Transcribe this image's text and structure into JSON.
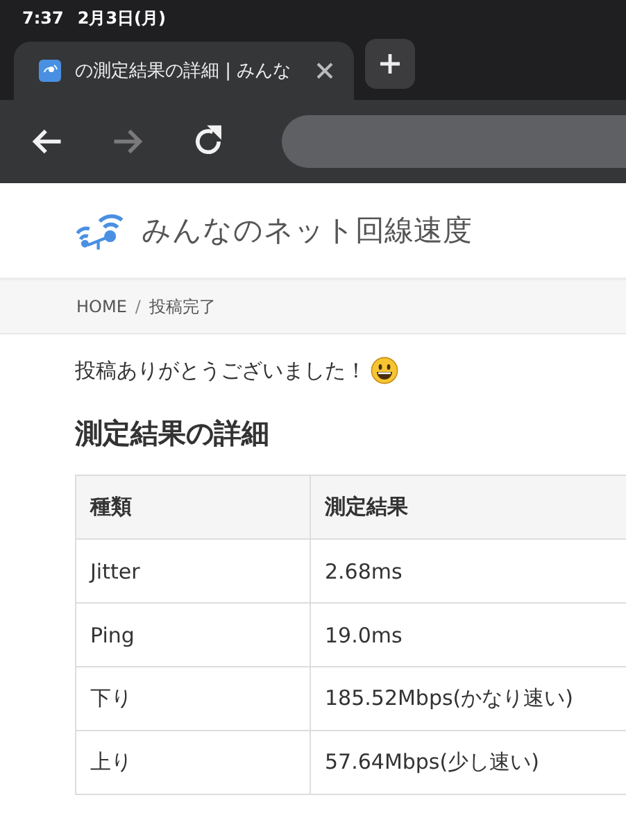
{
  "status_bar": {
    "time": "7:37",
    "date": "2月3日(月)"
  },
  "tabs": [
    {
      "title": "の測定結果の詳細 | みんな",
      "selected": true
    }
  ],
  "toolbar": {
    "buttons": [
      {
        "kind": "back",
        "disabled": false
      },
      {
        "kind": "forward",
        "disabled": true
      },
      {
        "kind": "reload",
        "disabled": false
      }
    ]
  },
  "site": {
    "logo_text": "みんなのネット回線速度"
  },
  "breadcrumb": [
    {
      "label": "HOME",
      "separator": "/"
    },
    {
      "label": "投稿完了"
    }
  ],
  "message": "投稿ありがとうございました！",
  "section_title": "測定結果の詳細",
  "table": {
    "columns": [
      "種類",
      "測定結果"
    ],
    "rows": [
      [
        "Jitter",
        "2.68ms"
      ],
      [
        "Ping",
        "19.0ms"
      ],
      [
        "下り",
        "185.52Mbps(かなり速い)"
      ],
      [
        "上り",
        "57.64Mbps(少し速い)"
      ]
    ]
  }
}
